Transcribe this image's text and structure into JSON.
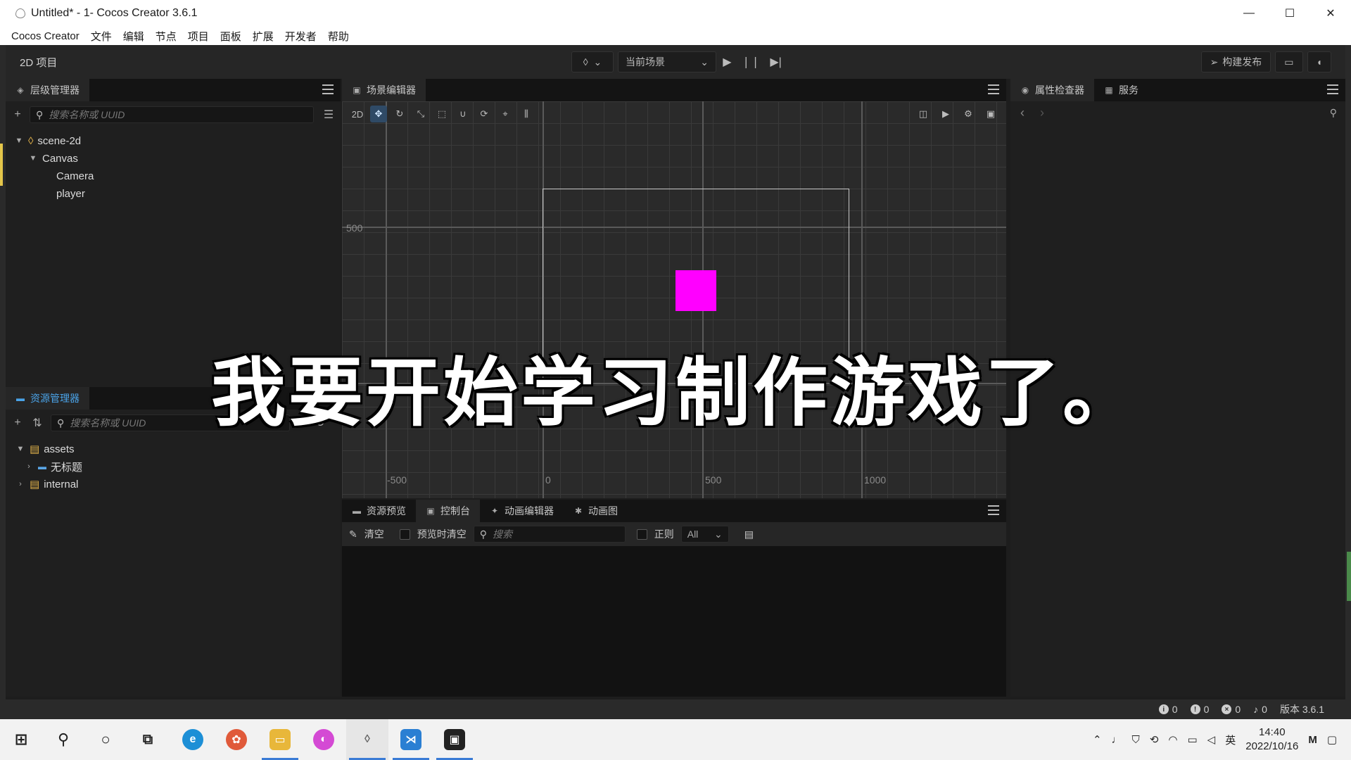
{
  "window": {
    "title": "Untitled* - 1- Cocos Creator 3.6.1",
    "minimize": "—",
    "maximize": "☐",
    "close": "✕"
  },
  "menu": [
    "Cocos Creator",
    "文件",
    "编辑",
    "节点",
    "项目",
    "面板",
    "扩展",
    "开发者",
    "帮助"
  ],
  "toolbar": {
    "project_label": "2D 项目",
    "scene_select": "当前场景",
    "build_label": "构建发布"
  },
  "hierarchy": {
    "tab": "层级管理器",
    "search_placeholder": "搜索名称或 UUID",
    "nodes": [
      "scene-2d",
      "Canvas",
      "Camera",
      "player"
    ]
  },
  "assets": {
    "tab": "资源管理器",
    "search_placeholder": "搜索名称或 UUID",
    "items": [
      "assets",
      "无标题",
      "internal"
    ]
  },
  "scene": {
    "tab": "场景编辑器",
    "mode_2d": "2D",
    "axis": {
      "y500": "500",
      "xm500": "-500",
      "x0": "0",
      "x500": "500",
      "x1000": "1000"
    },
    "sprite_color": "#ff00ff"
  },
  "bottom": {
    "tabs": [
      "资源预览",
      "控制台",
      "动画编辑器",
      "动画图"
    ],
    "clear": "清空",
    "clear_on_preview": "预览时清空",
    "search_placeholder": "搜索",
    "regex": "正则",
    "filter": "All"
  },
  "inspector": {
    "tabs": [
      "属性检查器",
      "服务"
    ]
  },
  "status": {
    "info": "0",
    "warn": "0",
    "error": "0",
    "notify": "0",
    "version": "版本 3.6.1"
  },
  "taskbar": {
    "time": "14:40",
    "date": "2022/10/16",
    "ime": "英"
  },
  "subtitle": "我要开始学习制作游戏了。"
}
